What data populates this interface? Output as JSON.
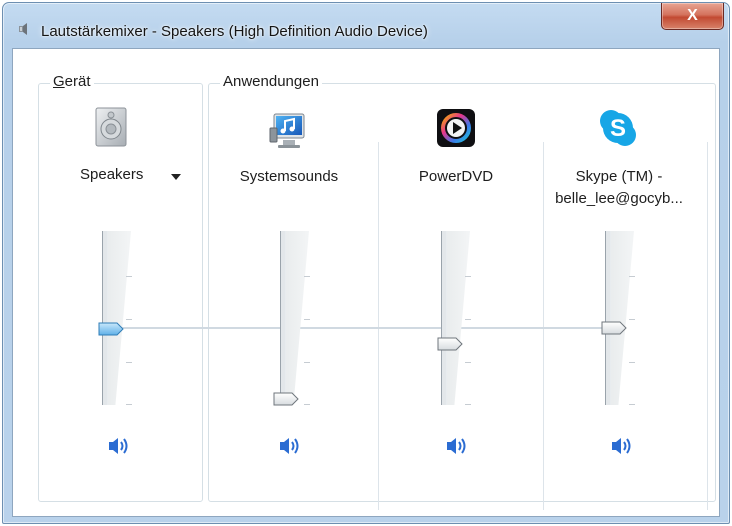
{
  "window": {
    "title": "Lautstärkemixer - Speakers (High Definition Audio Device)",
    "close_label": "X"
  },
  "device_group": {
    "legend": "Gerät",
    "legend_accel": "G",
    "legend_rest": "erät",
    "device": {
      "name": "Speakers",
      "icon": "speaker-device-icon",
      "volume_fraction": 0.55,
      "muted": false
    }
  },
  "apps_group": {
    "legend": "Anwendungen",
    "apps": [
      {
        "name": "Systemsounds",
        "icon": "system-sounds-icon",
        "volume_fraction": 0.02,
        "muted": false
      },
      {
        "name": "PowerDVD",
        "icon": "powerdvd-icon",
        "volume_fraction": 0.46,
        "muted": false
      },
      {
        "name_line1": "Skype (TM) -",
        "name_line2": "belle_lee@gocyb...",
        "icon": "skype-icon",
        "volume_fraction": 0.55,
        "muted": false
      }
    ]
  },
  "colors": {
    "accent_thumb": "#6fb6ea",
    "speaker_blue": "#2b6cd2",
    "skype_blue": "#17a6e6"
  }
}
